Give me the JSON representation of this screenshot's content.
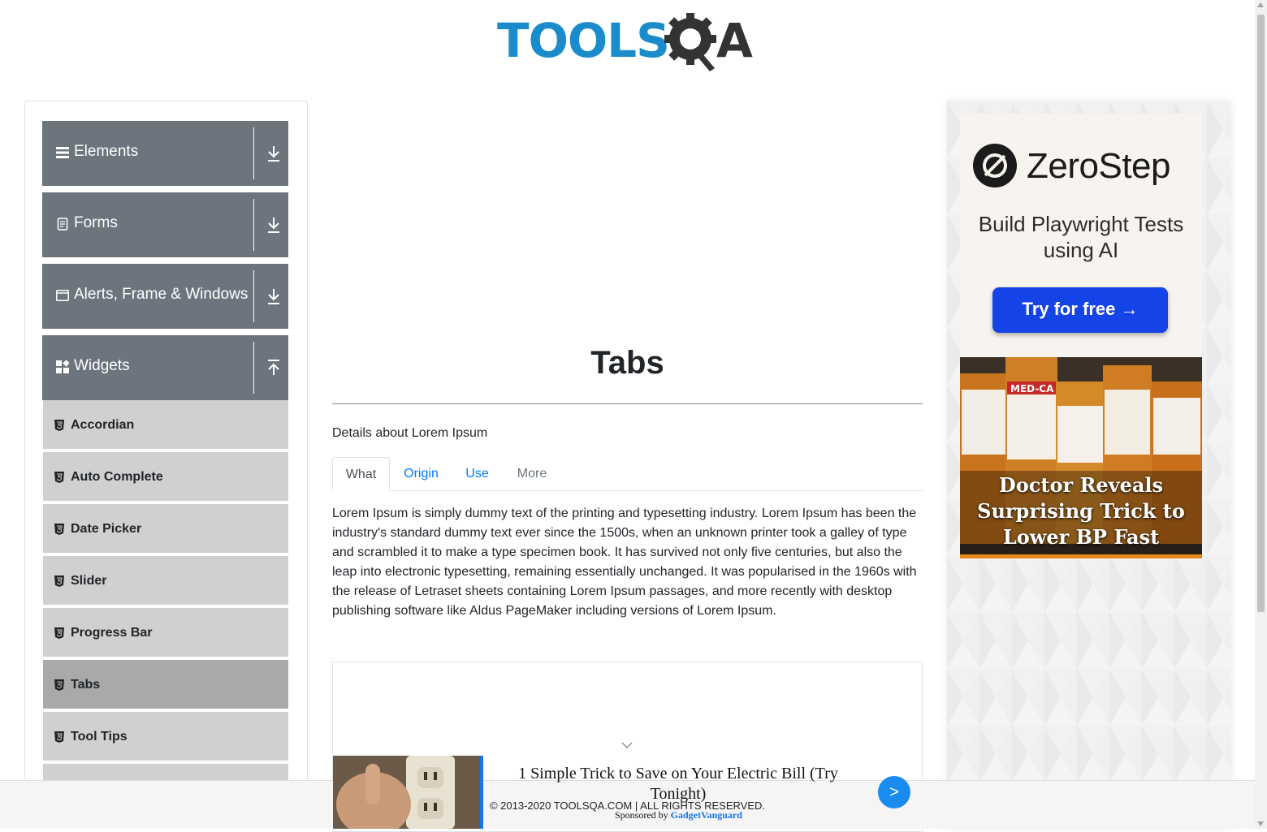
{
  "header": {
    "logo_primary": "TOOLS",
    "logo_secondary": "A"
  },
  "sidebar": {
    "groups": [
      {
        "label": "Elements",
        "icon": "hamburger-icon",
        "state": "collapsed"
      },
      {
        "label": "Forms",
        "icon": "document-icon",
        "state": "collapsed"
      },
      {
        "label": "Alerts, Frame & Windows",
        "icon": "window-icon",
        "state": "collapsed"
      },
      {
        "label": "Widgets",
        "icon": "widgets-icon",
        "state": "expanded"
      }
    ],
    "items": [
      {
        "label": "Accordian"
      },
      {
        "label": "Auto Complete"
      },
      {
        "label": "Date Picker"
      },
      {
        "label": "Slider"
      },
      {
        "label": "Progress Bar"
      },
      {
        "label": "Tabs",
        "active": true
      },
      {
        "label": "Tool Tips"
      }
    ]
  },
  "main": {
    "title": "Tabs",
    "details": "Details about Lorem Ipsum",
    "tabs": [
      {
        "label": "What",
        "state": "active"
      },
      {
        "label": "Origin",
        "state": "link"
      },
      {
        "label": "Use",
        "state": "link"
      },
      {
        "label": "More",
        "state": "disabled"
      }
    ],
    "content": "Lorem Ipsum is simply dummy text of the printing and typesetting industry. Lorem Ipsum has been the industry's standard dummy text ever since the 1500s, when an unknown printer took a galley of type and scrambled it to make a type specimen book. It has survived not only five centuries, but also the leap into electronic typesetting, remaining essentially unchanged. It was popularised in the 1960s with the release of Letraset sheets containing Lorem Ipsum passages, and more recently with desktop publishing software like Aldus PageMaker including versions of Lorem Ipsum."
  },
  "ads": {
    "zerostep": {
      "name": "ZeroStep",
      "tagline": "Build Playwright Tests using AI",
      "cta": "Try for free →"
    },
    "bp": {
      "headline": "Doctor Reveals Surprising Trick to Lower BP Fast",
      "bottle_label": "MED-CA"
    },
    "sticky": {
      "title": "1 Simple Trick to Save on Your Electric Bill (Try Tonight)",
      "sponsored_prefix": "Sponsored by",
      "sponsor": "GadgetVanguard",
      "go": ">"
    }
  },
  "footer": {
    "copyright": "© 2013-2020 TOOLSQA.COM | ALL RIGHTS RESERVED."
  },
  "colors": {
    "group_bg": "#6c757d",
    "item_bg": "#d0d0d0",
    "item_active_bg": "#a9a9a9",
    "link": "#007bff",
    "logo_blue": "#1a8ccb",
    "cta_blue": "#1444e8"
  }
}
